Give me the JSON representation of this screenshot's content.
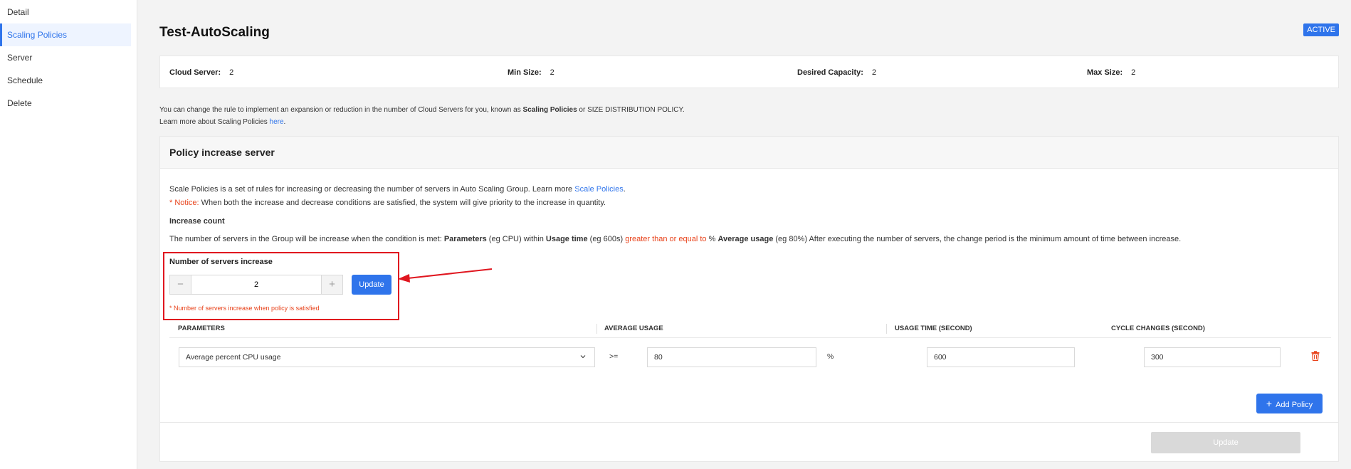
{
  "sidebar": {
    "items": [
      {
        "label": "Detail"
      },
      {
        "label": "Scaling Policies"
      },
      {
        "label": "Server"
      },
      {
        "label": "Schedule"
      },
      {
        "label": "Delete"
      }
    ]
  },
  "header": {
    "title": "Test-AutoScaling",
    "status": "ACTIVE"
  },
  "summary": {
    "cloud_server_label": "Cloud Server:",
    "cloud_server_value": "2",
    "min_size_label": "Min Size:",
    "min_size_value": "2",
    "desired_capacity_label": "Desired Capacity:",
    "desired_capacity_value": "2",
    "max_size_label": "Max Size:",
    "max_size_value": "2"
  },
  "info": {
    "line1_pre": "You can change the rule to implement an expansion or reduction in the number of Cloud Servers for you, known as ",
    "line1_bold": "Scaling Policies",
    "line1_post": " or SIZE DISTRIBUTION POLICY.",
    "line2_pre": "Learn more about Scaling Policies ",
    "line2_link": "here",
    "line2_post": "."
  },
  "policy": {
    "title": "Policy increase server",
    "desc_pre": "Scale Policies is a set of rules for increasing or decreasing the number of servers in Auto Scaling Group. Learn more ",
    "desc_link": "Scale Policies",
    "desc_post": ".",
    "notice_label": "* Notice:",
    "notice_text": " When both the increase and decrease conditions are satisfied, the system will give priority to the increase in quantity.",
    "section_title": "Increase count",
    "rule": {
      "t1": "The number of servers in the Group will be increase when the condition is met: ",
      "b1": "Parameters",
      "t2": " (eg CPU) within ",
      "b2": "Usage time",
      "t3": " (eg 600s) ",
      "r1": "greater than or equal to",
      "t4": " % ",
      "b3": "Average usage",
      "t5": " (eg 80%) After executing the number of servers, the change period is the minimum amount of time between increase."
    },
    "increase_label": "Number of servers increase",
    "increase_value": "2",
    "minus_symbol": "−",
    "plus_symbol": "+",
    "update_label": "Update",
    "increase_hint": "* Number of servers increase when policy is satisfied",
    "columns": {
      "parameters": "PARAMETERS",
      "average_usage": "AVERAGE USAGE",
      "usage_time": "USAGE TIME (SECOND)",
      "cycle_changes": "CYCLE CHANGES (SECOND)"
    },
    "row": {
      "parameter": "Average percent CPU usage",
      "operator": ">=",
      "average_usage": "80",
      "unit": "%",
      "usage_time": "600",
      "cycle_changes": "300"
    },
    "add_policy_label": "Add Policy",
    "footer_update_label": "Update"
  },
  "colors": {
    "accent": "#2f74eb",
    "notice": "#e8421a",
    "highlight_frame": "#e0161f",
    "delete_icon": "#e8421a"
  }
}
